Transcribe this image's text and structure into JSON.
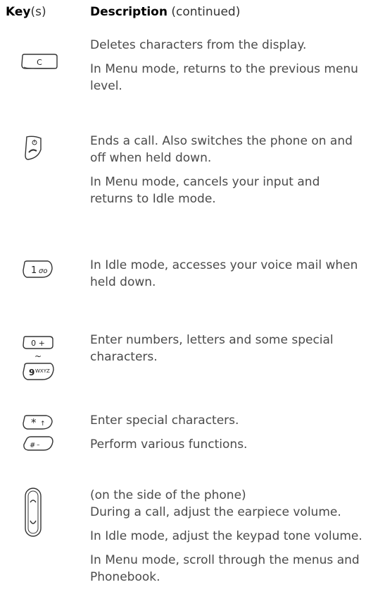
{
  "header": {
    "key_label": "Key",
    "key_suffix": "(s)",
    "desc_label": "Description",
    "desc_suffix": " (continued)"
  },
  "rows": [
    {
      "icon": "clear-key-icon",
      "key_text": "C",
      "lines": [
        "Deletes characters from the display.",
        "In Menu mode, returns to the previous menu level."
      ]
    },
    {
      "icon": "end-call-key-icon",
      "lines": [
        "Ends a call. Also switches the phone on and off when held down.",
        "In Menu mode, cancels your input and returns to Idle mode."
      ]
    },
    {
      "icon": "voicemail-key-1-icon",
      "key_text": "1",
      "lines": [
        "In Idle mode, accesses your voice mail when held down."
      ]
    },
    {
      "icon": "number-keys-0-9-icon",
      "key_text_top": "0 +",
      "key_text_mid": "~",
      "key_text_bottom": "9",
      "key_text_bottom_sub": "WXYZ",
      "lines": [
        "Enter numbers, letters and some special characters."
      ]
    },
    {
      "icon": "star-hash-keys-icon",
      "key_text_top": "*",
      "key_text_bottom": "#",
      "lines": [
        "Enter special characters.",
        "Perform various functions."
      ]
    },
    {
      "icon": "volume-side-key-icon",
      "lines": [
        "(on the side of the phone)",
        "During a call, adjust the earpiece volume.",
        "In Idle mode, adjust the keypad tone volume.",
        "In Menu mode, scroll through the menus and Phonebook."
      ]
    }
  ]
}
